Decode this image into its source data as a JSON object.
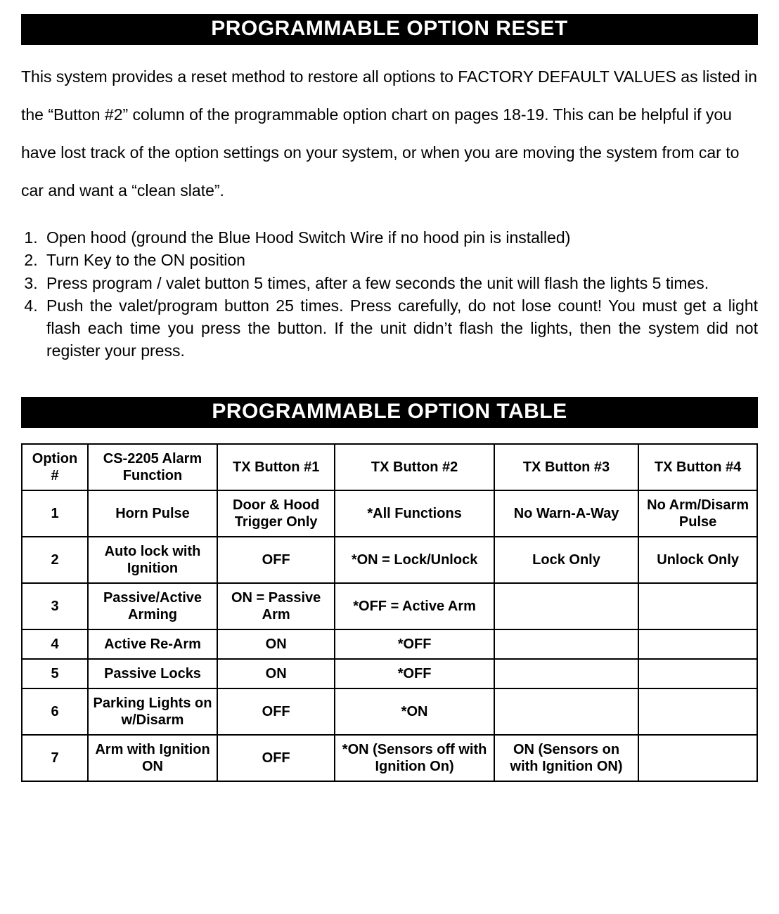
{
  "banner1": "PROGRAMMABLE OPTION RESET",
  "intro": "This system provides a reset method to restore all options to FACTORY DEFAULT VALUES as listed in the “Button #2” column of the programmable option chart on pages 18-19.  This can be helpful if you have lost track of the option settings on your system, or when you are moving the system from car to car and want a “clean slate”.",
  "steps": [
    "Open hood (ground the Blue Hood Switch Wire if no hood pin is installed)",
    "Turn Key to the ON position",
    "Press program / valet button 5 times, after a few seconds the unit will flash the lights 5 times.",
    "Push the valet/program button 25 times.  Press carefully, do not lose count!  You must get a light flash each time you press the button.   If the unit didn’t flash the lights, then the system did not register your press."
  ],
  "banner2": "PROGRAMMABLE OPTION TABLE",
  "table": {
    "headers": [
      "Option #",
      "CS-2205 Alarm Function",
      "TX Button #1",
      "TX Button #2",
      "TX Button #3",
      "TX Button #4"
    ],
    "rows": [
      [
        "1",
        "Horn Pulse",
        "Door & Hood Trigger Only",
        "*All Functions",
        "No Warn-A-Way",
        "No Arm/Disarm Pulse"
      ],
      [
        "2",
        "Auto lock with Ignition",
        "OFF",
        "*ON = Lock/Unlock",
        "Lock Only",
        "Unlock Only"
      ],
      [
        "3",
        "Passive/Active Arming",
        "ON = Passive Arm",
        "*OFF = Active Arm",
        "",
        ""
      ],
      [
        "4",
        "Active Re-Arm",
        "ON",
        "*OFF",
        "",
        ""
      ],
      [
        "5",
        "Passive Locks",
        "ON",
        "*OFF",
        "",
        ""
      ],
      [
        "6",
        "Parking Lights on w/Disarm",
        "OFF",
        "*ON",
        "",
        ""
      ],
      [
        "7",
        "Arm with Ignition ON",
        "OFF",
        "*ON (Sensors off with Ignition On)",
        "ON (Sensors on with Ignition ON)",
        ""
      ]
    ]
  }
}
